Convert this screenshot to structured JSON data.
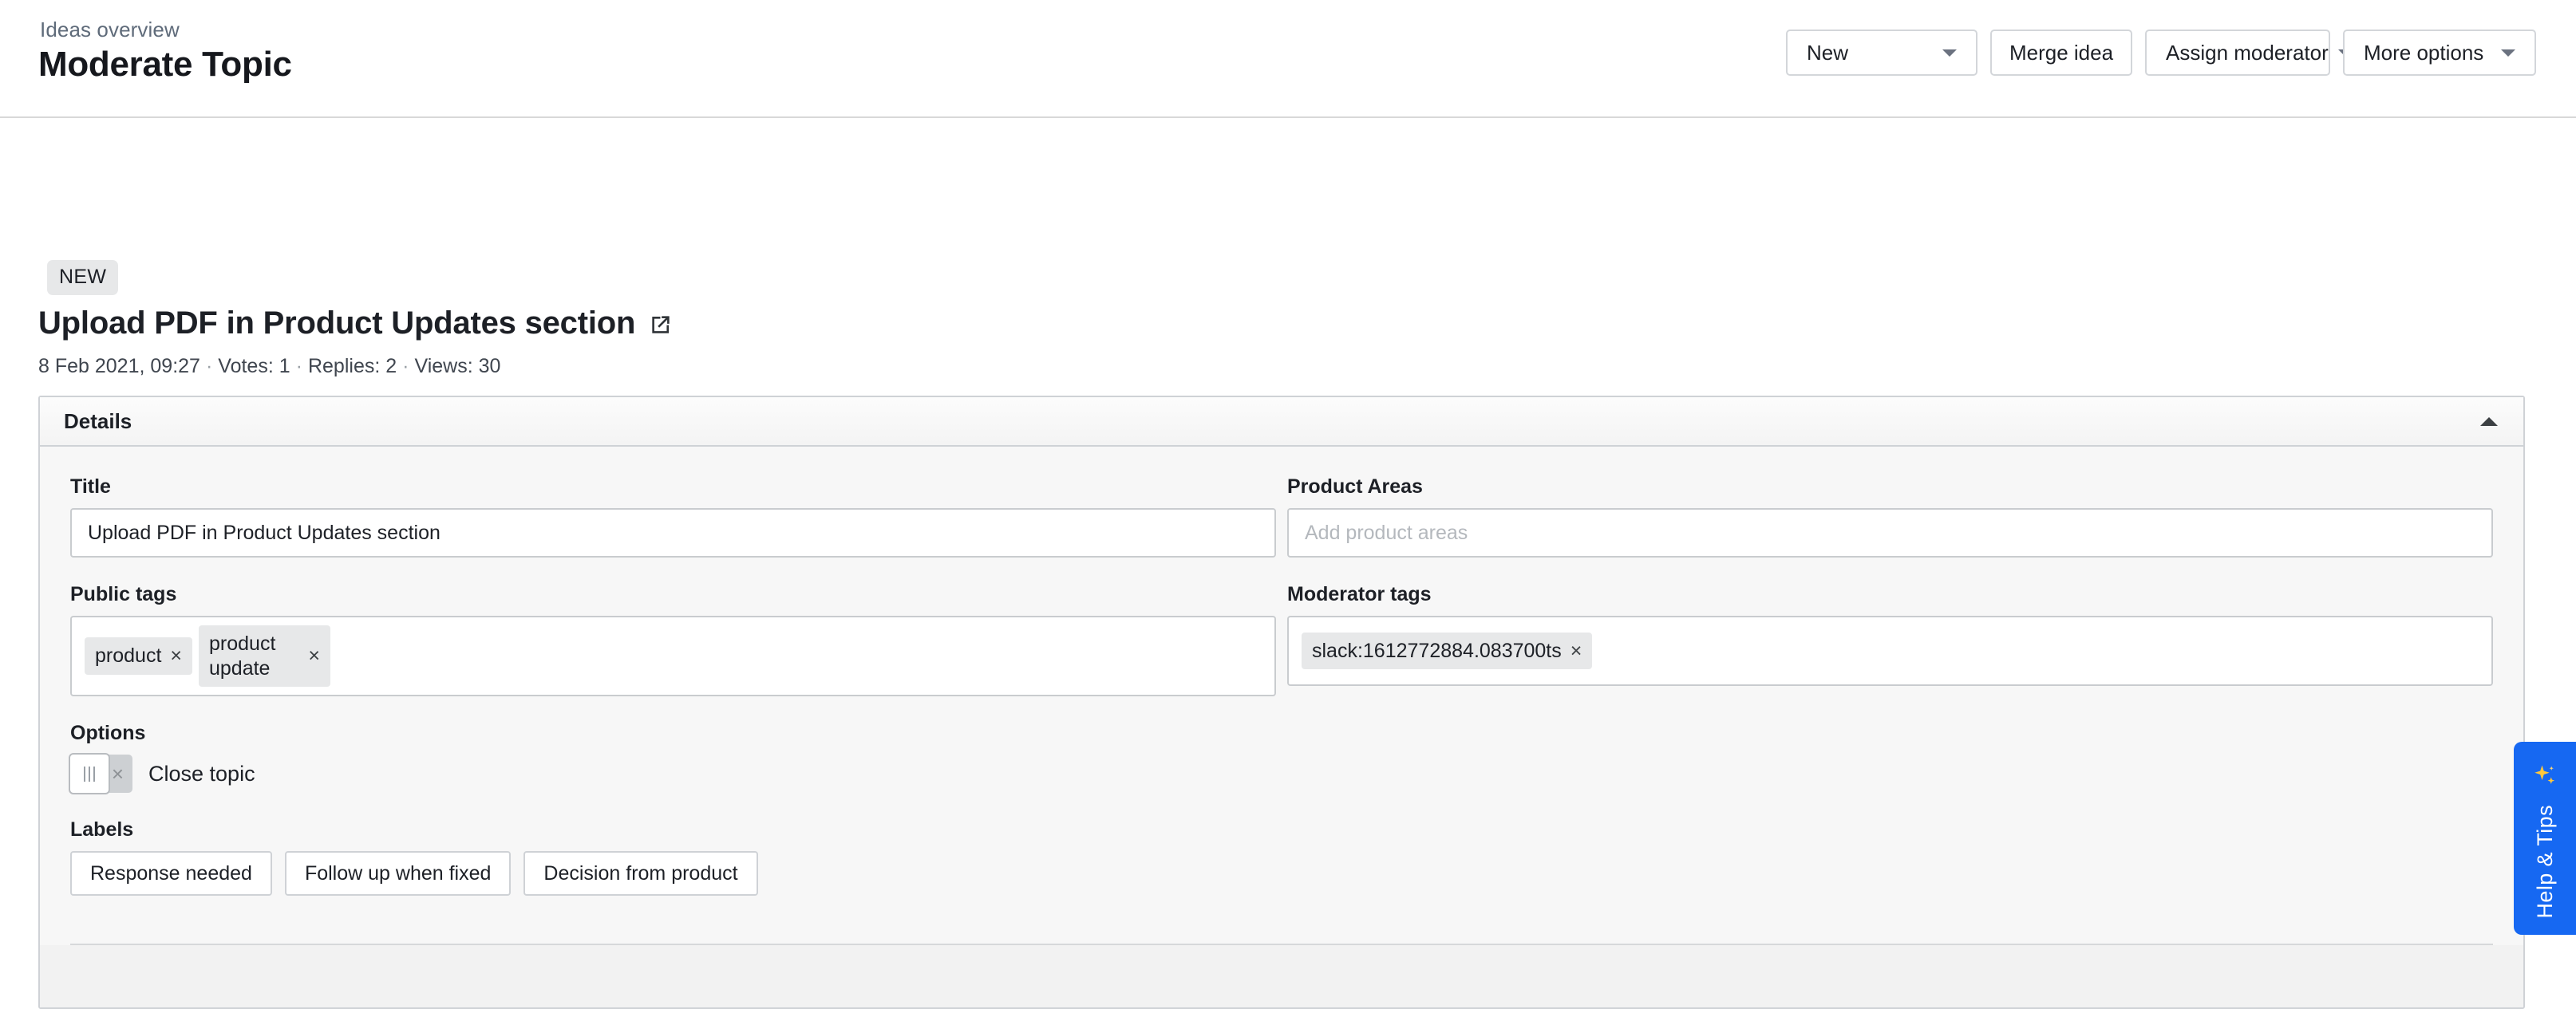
{
  "header": {
    "breadcrumb": "Ideas overview",
    "title": "Moderate Topic",
    "actions": {
      "new_label": "New",
      "merge_label": "Merge idea",
      "assign_label": "Assign moderator",
      "more_label": "More options"
    }
  },
  "topic": {
    "badge": "NEW",
    "title": "Upload PDF in Product Updates section",
    "external_link_icon": "external-link-icon",
    "meta": {
      "date": "8 Feb 2021, 09:27",
      "votes": "Votes: 1",
      "replies": "Replies: 2",
      "views": "Views: 30",
      "separator": "·"
    }
  },
  "details": {
    "section_title": "Details",
    "collapse_icon": "chevron-up-icon",
    "title_field": {
      "label": "Title",
      "value": "Upload PDF in Product Updates section"
    },
    "product_areas_field": {
      "label": "Product Areas",
      "value": "",
      "placeholder": "Add product areas"
    },
    "public_tags": {
      "label": "Public tags",
      "tags": [
        {
          "text": "product",
          "remove": "×"
        },
        {
          "text": "product update",
          "remove": "×"
        }
      ]
    },
    "moderator_tags": {
      "label": "Moderator tags",
      "tags": [
        {
          "text": "slack:1612772884.083700ts",
          "remove": "×"
        }
      ]
    },
    "options": {
      "label": "Options",
      "close_topic": {
        "label": "Close topic",
        "state": "off",
        "off_glyph": "×"
      }
    },
    "labels": {
      "label": "Labels",
      "buttons": [
        "Response needed",
        "Follow up when fixed",
        "Decision from product"
      ]
    }
  },
  "help_tab": {
    "label": "Help & Tips",
    "icon": "sparkle-icon",
    "color": "#1668f2"
  }
}
